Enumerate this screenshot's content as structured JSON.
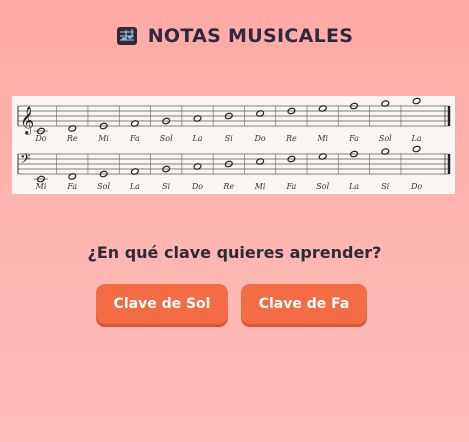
{
  "app": {
    "title": "NOTAS MUSICALES",
    "logo_icon": "music-notes-icon",
    "colors": {
      "background": "#ffb0aa",
      "accent": "#f36c45",
      "text": "#2b2b3b"
    }
  },
  "staff": {
    "treble_notes": [
      "Do",
      "Re",
      "Mi",
      "Fa",
      "Sol",
      "La",
      "Si",
      "Do",
      "Re",
      "Mi",
      "Fa",
      "Sol",
      "La"
    ],
    "bass_notes": [
      "Mi",
      "Fa",
      "Sol",
      "La",
      "Si",
      "Do",
      "Re",
      "Mi",
      "Fa",
      "Sol",
      "La",
      "Si",
      "Do"
    ]
  },
  "prompt": {
    "question": "¿En qué clave quieres aprender?"
  },
  "buttons": {
    "sol": "Clave de Sol",
    "fa": "Clave de Fa"
  }
}
